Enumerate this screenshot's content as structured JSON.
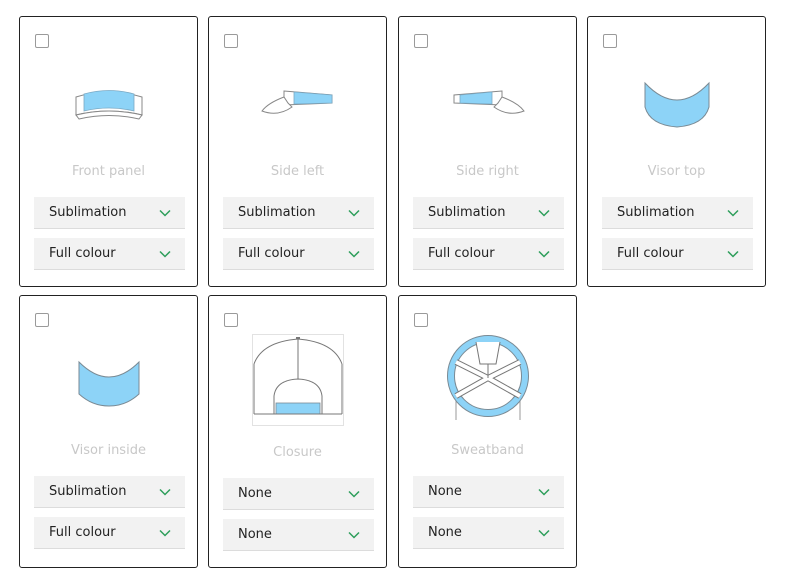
{
  "colors": {
    "accent_green": "#2e9e5b",
    "fill_blue": "#8dd3f7",
    "border": "#222222",
    "label_gray": "#c8c8c8"
  },
  "cards": [
    {
      "label": "Front panel",
      "checked": false,
      "icon": "cap-front-panel-icon",
      "selects": [
        "Sublimation",
        "Full colour"
      ]
    },
    {
      "label": "Side left",
      "checked": false,
      "icon": "cap-side-left-icon",
      "selects": [
        "Sublimation",
        "Full colour"
      ]
    },
    {
      "label": "Side right",
      "checked": false,
      "icon": "cap-side-right-icon",
      "selects": [
        "Sublimation",
        "Full colour"
      ]
    },
    {
      "label": "Visor top",
      "checked": false,
      "icon": "visor-top-icon",
      "selects": [
        "Sublimation",
        "Full colour"
      ]
    },
    {
      "label": "Visor inside",
      "checked": false,
      "icon": "visor-inside-icon",
      "selects": [
        "Sublimation",
        "Full colour"
      ]
    },
    {
      "label": "Closure",
      "checked": false,
      "icon": "cap-closure-icon",
      "selects": [
        "None",
        "None"
      ]
    },
    {
      "label": "Sweatband",
      "checked": false,
      "icon": "cap-sweatband-icon",
      "selects": [
        "None",
        "None"
      ]
    }
  ]
}
